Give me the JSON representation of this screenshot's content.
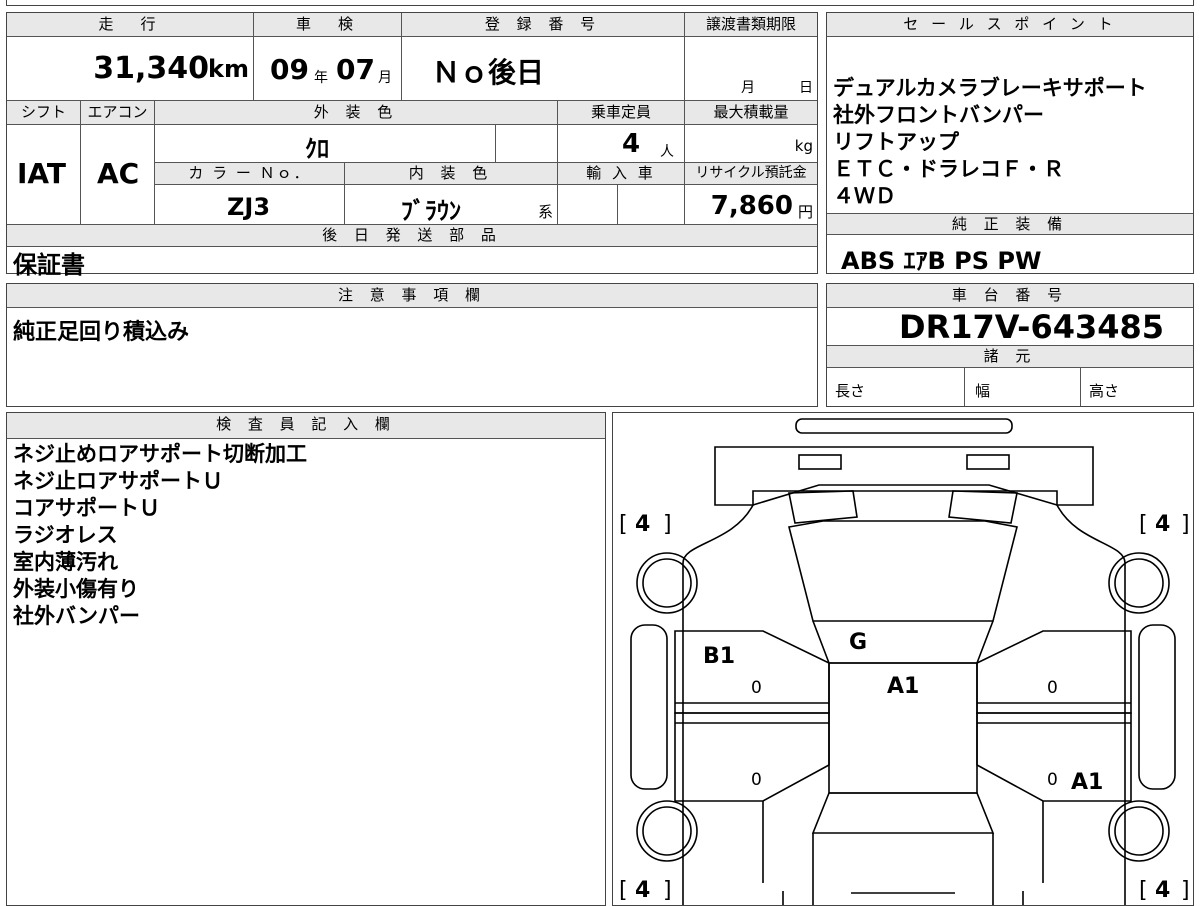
{
  "header": {
    "mileage_label": "走　行",
    "mileage_value": "31,340",
    "mileage_unit": "km",
    "shaken_label": "車　検",
    "shaken_year": "09",
    "shaken_year_unit": "年",
    "shaken_month": "07",
    "shaken_month_unit": "月",
    "registration_label": "登 録 番 号",
    "registration_value": "Ｎｏ後日",
    "transfer_label": "譲渡書類期限",
    "transfer_month_unit": "月",
    "transfer_day_unit": "日",
    "shift_label": "シフト",
    "shift_value": "IAT",
    "ac_label": "エアコン",
    "ac_value": "AC",
    "exterior_color_label": "外 装 色",
    "exterior_color_value": "ｸﾛ",
    "capacity_label": "乗車定員",
    "capacity_value": "4",
    "capacity_unit": "人",
    "max_load_label": "最大積載量",
    "max_load_unit": "kg",
    "color_no_label": "カ ラ ー Ｎｏ．",
    "color_no_value": "ZJ3",
    "interior_color_label": "内 装 色",
    "interior_color_value": "ﾌﾞﾗｳﾝ",
    "interior_color_suffix": "系",
    "import_label": "輸 入 車",
    "recycle_label": "リサイクル預託金",
    "recycle_value": "7,860",
    "recycle_unit": "円",
    "later_parts_label": "後 日 発 送 部 品",
    "later_parts_value": "保証書"
  },
  "sales_points": {
    "label": "セ ー ル ス ポ イ ン ト",
    "lines": [
      "デュアルカメラブレーキサポート",
      "社外フロントバンパー",
      "リフトアップ",
      "ＥＴＣ・ドラレコＦ・Ｒ",
      "４ＷＤ"
    ]
  },
  "genuine_equipment": {
    "label": "純 正 装 備",
    "value": "ABS ｴｱB PS PW"
  },
  "notes": {
    "label": "注 意 事 項 欄",
    "value": "純正足回り積込み"
  },
  "chassis": {
    "label": "車 台 番 号",
    "value": "DR17V-643485"
  },
  "specs": {
    "label": "諸 元",
    "length_label": "長さ",
    "width_label": "幅",
    "height_label": "高さ"
  },
  "inspector": {
    "label": "検 査 員 記 入 欄",
    "lines": [
      "ネジ止めロアサポート切断加工",
      "ネジ止ロアサポートＵ",
      "コアサポートＵ",
      "ラジオレス",
      "室内薄汚れ",
      "外装小傷有り",
      "社外バンパー"
    ]
  },
  "diagram": {
    "tire_fl": "4",
    "tire_fr": "4",
    "tire_rl": "4",
    "tire_rr": "4",
    "mark_door_fl": "B1",
    "mark_door_fl_num": "0",
    "mark_door_rl_num": "0",
    "mark_door_fr_num": "0",
    "mark_door_rr_num": "0",
    "mark_windshield": "G",
    "mark_roof": "A1",
    "mark_rear_right": "A1",
    "bracket_open": "[",
    "bracket_close": "]"
  }
}
